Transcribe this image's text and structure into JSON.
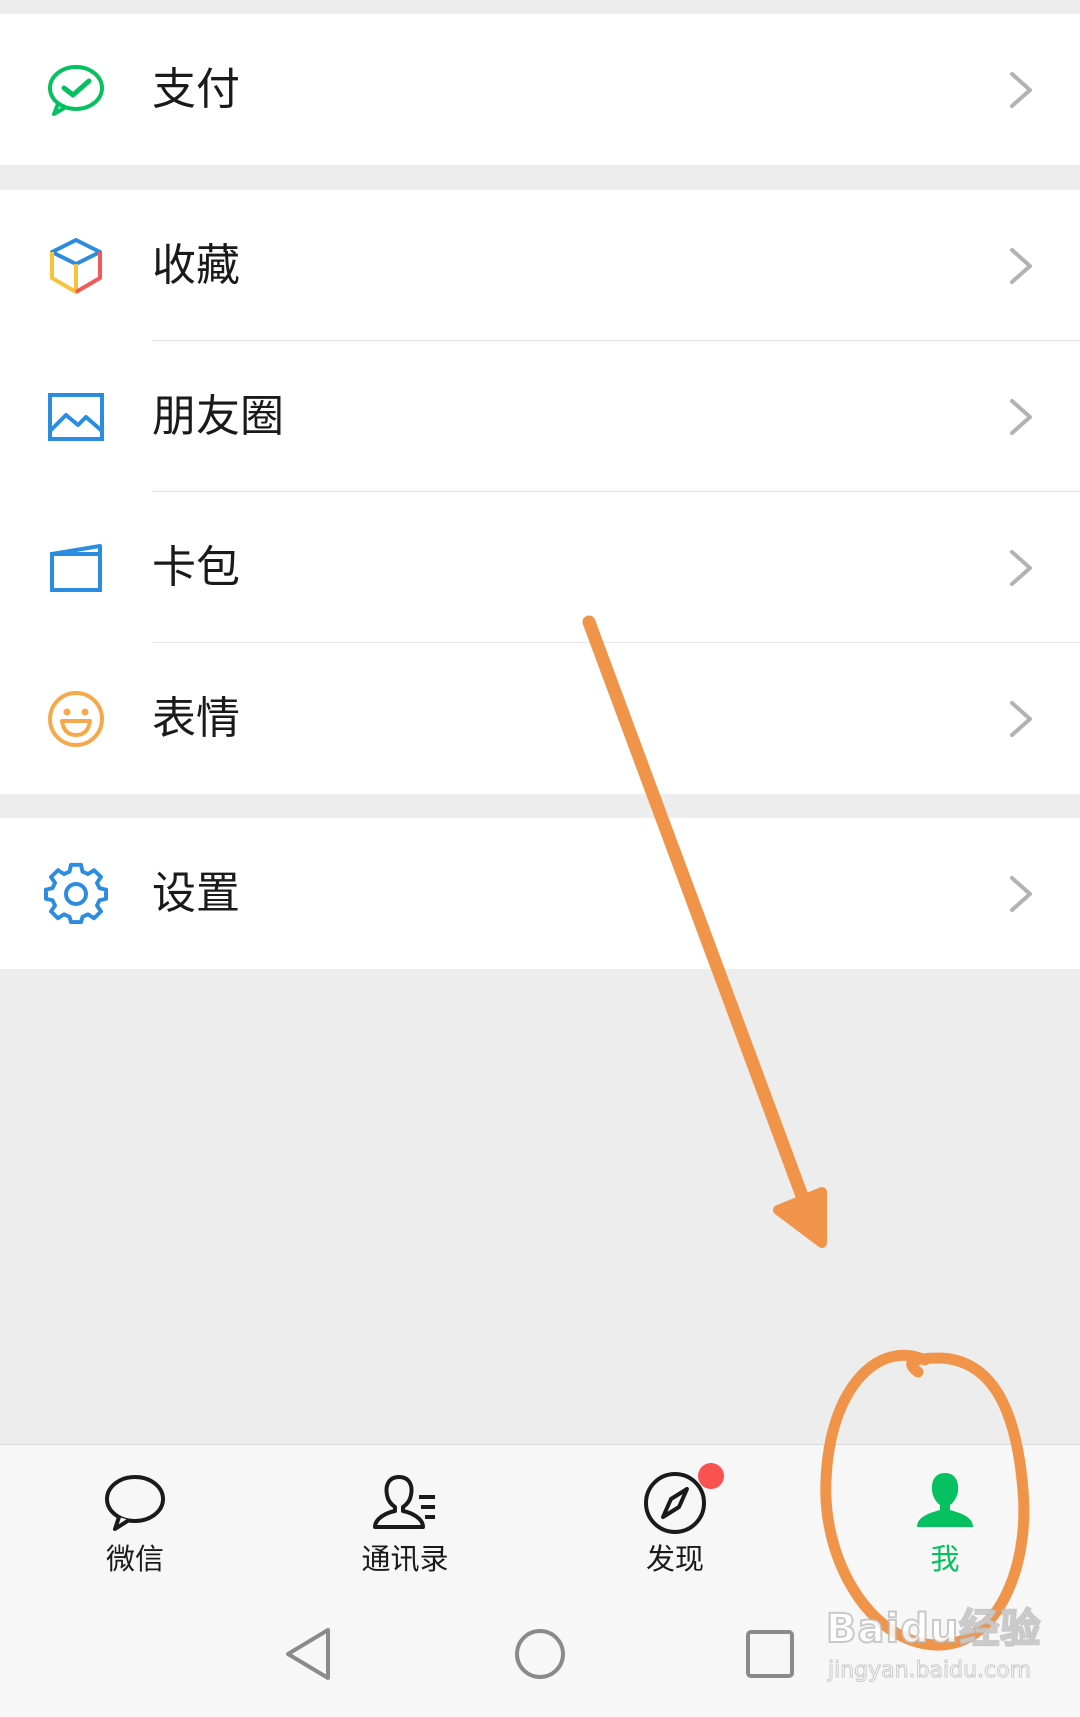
{
  "menu": {
    "pay": {
      "label": "支付",
      "icon": "wechat-pay-icon",
      "color": "#07c160"
    },
    "group2": [
      {
        "label": "收藏",
        "icon": "favorites-cube-icon"
      },
      {
        "label": "朋友圈",
        "icon": "moments-image-icon",
        "color": "#2c8ce0"
      },
      {
        "label": "卡包",
        "icon": "card-wallet-icon",
        "color": "#2c8ce0"
      },
      {
        "label": "表情",
        "icon": "sticker-smile-icon",
        "color": "#f5a94a"
      }
    ],
    "settings": {
      "label": "设置",
      "icon": "gear-icon",
      "color": "#2c8ce0"
    }
  },
  "tabbar": {
    "tabs": [
      {
        "label": "微信",
        "icon": "chat-bubble-icon"
      },
      {
        "label": "通讯录",
        "icon": "contacts-icon"
      },
      {
        "label": "发现",
        "icon": "compass-icon",
        "badge": "dot"
      },
      {
        "label": "我",
        "icon": "me-person-icon",
        "active": true
      }
    ],
    "active_color": "#07c160",
    "badge_color": "#fa5151"
  },
  "system_nav": [
    "back-triangle-icon",
    "home-circle-icon",
    "recents-square-icon"
  ],
  "annotation": {
    "color": "#f0944a",
    "shapes": [
      "arrow",
      "circle"
    ]
  },
  "watermark": {
    "main": "Baidu经验",
    "sub": "jingyan.baidu.com"
  }
}
